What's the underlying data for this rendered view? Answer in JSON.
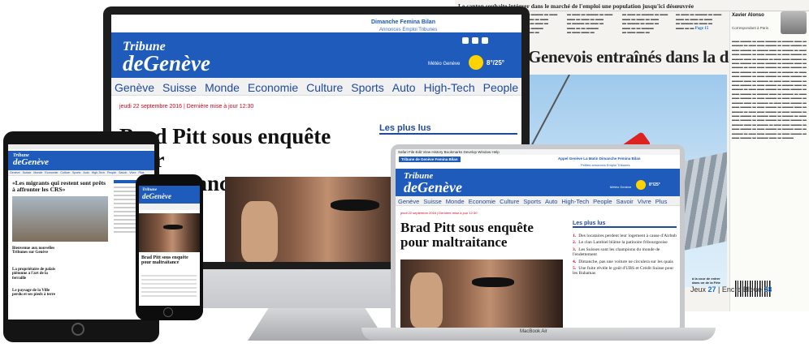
{
  "newspaper": {
    "top_banner": "Le canton souhaite intégrer dans le marché de l'emploi une population jusqu'ici désœuvrée",
    "headline": "Genevois entraînés dans la danse",
    "author_name": "Xavier Alonso",
    "author_role": "Correspondant à Paris",
    "page_ref": "Page 15",
    "footer_prefix": "Jeux ",
    "footer_page1": "27",
    "footer_middle": " | Encre Bleue ",
    "footer_page2": "28",
    "caption": "à la cour de entrer dans on de la Fête"
  },
  "site": {
    "tabs": "Tribune de Genève   Femina   Bilan",
    "tabs_right": "Dimanche  Femina  Bilan",
    "actions": "Annonces  Emploi  Tribunes",
    "logo_top": "Tribune",
    "logo_bottom": "deGenève",
    "weather_label": "Météo Genève",
    "temperature": "8°/25°",
    "nav": [
      "Genève",
      "Suisse",
      "Monde",
      "Economie",
      "Culture",
      "Sports",
      "Auto",
      "High-Tech",
      "People",
      "Savoir",
      "Vivre",
      "Plus"
    ],
    "date": "jeudi 22 septembre 2016 | Dernière mise à jour 12:30",
    "headline": "Brad Pitt sous enquête pour maltraitance",
    "headline_monitor": "Brad Pitt sous enquête pour\nmaltraitance",
    "popular_title": "Les plus lus",
    "popular_items": [
      "Des locataires perdent leur logement à cause d'Airbnb",
      "Le clan Lambiel blâme la patinoire fribourgeoise",
      "Les Suisses sont les champions du monde de l'endettement",
      "Dimanche, pas une voiture ne circulera sur les quais",
      "Une fuite révèle le goût d'UBS et Crédit Suisse pour les Bahamas"
    ]
  },
  "laptop": {
    "menubar": "  Safari   File   Edit   View   History   Bookmarks   Develop   Window   Help",
    "label": "MacBook Air",
    "tabs_right": "Appel Genève   La Matin Dimanche   Femina   Bilan",
    "actions": "Petites annonces   Emploi   Tribunes"
  },
  "tablet": {
    "headline": "«Les migrants qui restent sont prêts à affronter les CRS»",
    "teaser1": "Bienvenue aux nouvelles Tribunes sur Genève",
    "teaser2": "La propriétaire de palais piétonne a l'art de la ferraille",
    "teaser3": "Le paysage de la Ville perdu et ses pieds à terre"
  },
  "phone": {
    "headline": "Brad Pitt sous enquête pour maltraitance"
  }
}
